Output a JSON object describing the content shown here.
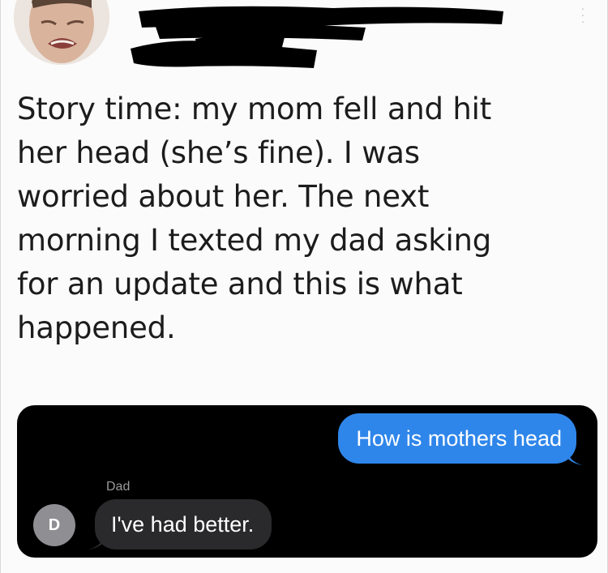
{
  "tweet": {
    "text": "Story time: my mom fell and hit her head (she’s fine). I was worried about her. The next morning I texted my dad asking for an update and this is what happened.",
    "lines": [
      "Story time: my mom fell and hit",
      "her head (she’s fine). I was",
      "worried about her. The next",
      "morning I texted my dad asking",
      "for an update and this is what",
      "happened."
    ],
    "more_icon": "vertical-dots-icon"
  },
  "messages": {
    "outgoing": "How is mothers head",
    "sender_name": "Dad",
    "contact_initial": "D",
    "incoming": "I've had better."
  },
  "colors": {
    "outgoing_bubble": "#2f86ea",
    "incoming_bubble": "#2a2a2c",
    "sms_background": "#000000",
    "contact_avatar": "#8e8e93",
    "redaction": "#000000"
  }
}
